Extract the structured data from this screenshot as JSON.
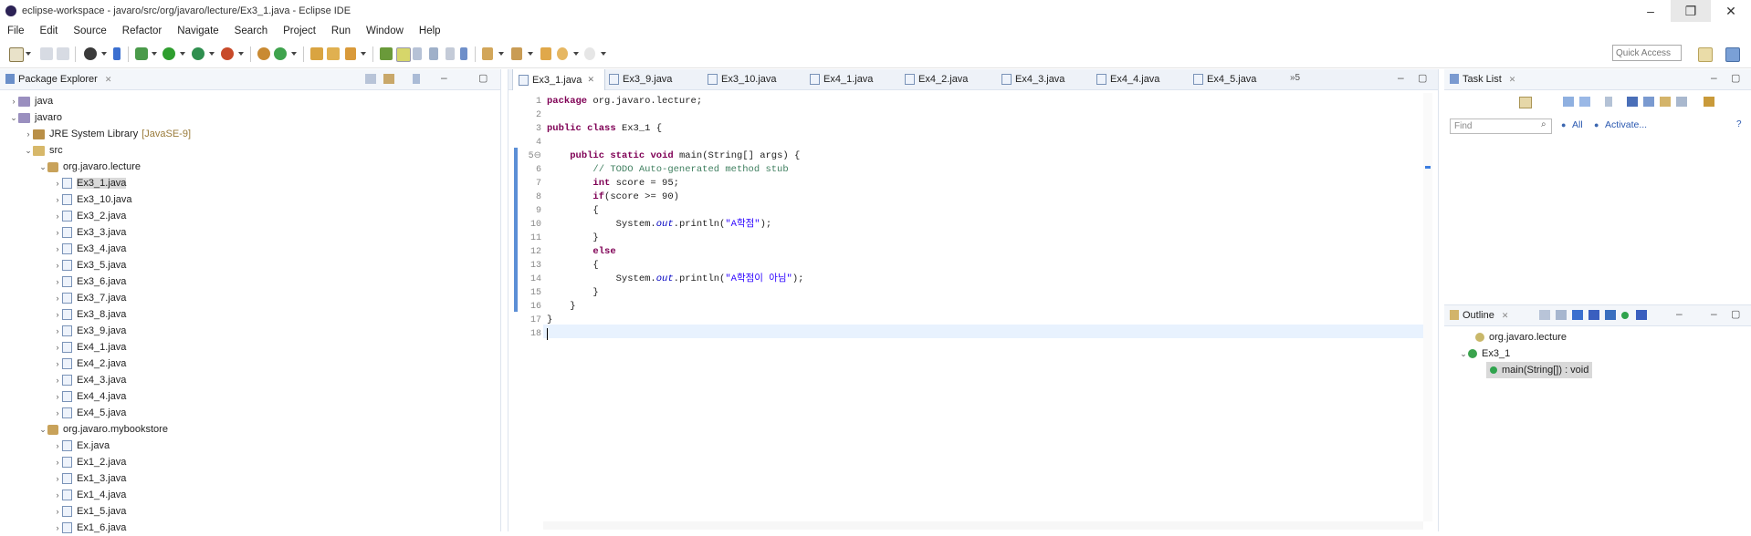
{
  "window": {
    "title": "eclipse-workspace - javaro/src/org/javaro/lecture/Ex3_1.java - Eclipse IDE"
  },
  "menu": [
    "File",
    "Edit",
    "Source",
    "Refactor",
    "Navigate",
    "Search",
    "Project",
    "Run",
    "Window",
    "Help"
  ],
  "toolbar": {
    "quick_access_placeholder": "Quick Access"
  },
  "package_explorer": {
    "title": "Package Explorer",
    "tree": [
      {
        "label": "java",
        "chevron": "›",
        "icon": "project"
      },
      {
        "label": "javaro",
        "chevron": "⌄",
        "icon": "project"
      },
      {
        "label": "JRE System Library",
        "suffix": "[JavaSE-9]",
        "chevron": "›",
        "icon": "library"
      },
      {
        "label": "src",
        "chevron": "⌄",
        "icon": "source-folder"
      },
      {
        "label": "org.javaro.lecture",
        "chevron": "⌄",
        "icon": "package"
      },
      {
        "label": "Ex3_1.java",
        "chevron": "›",
        "icon": "java-file",
        "selected": true
      },
      {
        "label": "Ex3_10.java",
        "chevron": "›",
        "icon": "java-file"
      },
      {
        "label": "Ex3_2.java",
        "chevron": "›",
        "icon": "java-file"
      },
      {
        "label": "Ex3_3.java",
        "chevron": "›",
        "icon": "java-file"
      },
      {
        "label": "Ex3_4.java",
        "chevron": "›",
        "icon": "java-file"
      },
      {
        "label": "Ex3_5.java",
        "chevron": "›",
        "icon": "java-file"
      },
      {
        "label": "Ex3_6.java",
        "chevron": "›",
        "icon": "java-file"
      },
      {
        "label": "Ex3_7.java",
        "chevron": "›",
        "icon": "java-file"
      },
      {
        "label": "Ex3_8.java",
        "chevron": "›",
        "icon": "java-file"
      },
      {
        "label": "Ex3_9.java",
        "chevron": "›",
        "icon": "java-file"
      },
      {
        "label": "Ex4_1.java",
        "chevron": "›",
        "icon": "java-file"
      },
      {
        "label": "Ex4_2.java",
        "chevron": "›",
        "icon": "java-file"
      },
      {
        "label": "Ex4_3.java",
        "chevron": "›",
        "icon": "java-file"
      },
      {
        "label": "Ex4_4.java",
        "chevron": "›",
        "icon": "java-file"
      },
      {
        "label": "Ex4_5.java",
        "chevron": "›",
        "icon": "java-file"
      },
      {
        "label": "org.javaro.mybookstore",
        "chevron": "⌄",
        "icon": "package"
      },
      {
        "label": "Ex.java",
        "chevron": "›",
        "icon": "java-file"
      },
      {
        "label": "Ex1_2.java",
        "chevron": "›",
        "icon": "java-file"
      },
      {
        "label": "Ex1_3.java",
        "chevron": "›",
        "icon": "java-file"
      },
      {
        "label": "Ex1_4.java",
        "chevron": "›",
        "icon": "java-file"
      },
      {
        "label": "Ex1_5.java",
        "chevron": "›",
        "icon": "java-file"
      },
      {
        "label": "Ex1_6.java",
        "chevron": "›",
        "icon": "java-file"
      }
    ]
  },
  "editor": {
    "tabs": [
      {
        "label": "Ex3_1.java",
        "active": true
      },
      {
        "label": "Ex3_9.java"
      },
      {
        "label": "Ex3_10.java"
      },
      {
        "label": "Ex4_1.java"
      },
      {
        "label": "Ex4_2.java"
      },
      {
        "label": "Ex4_3.java"
      },
      {
        "label": "Ex4_4.java"
      },
      {
        "label": "Ex4_5.java"
      }
    ],
    "overflow_count": "»5",
    "lines": [
      {
        "n": "1",
        "t": "package org.javaro.lecture;"
      },
      {
        "n": "2",
        "t": ""
      },
      {
        "n": "3",
        "t": "public class Ex3_1 {"
      },
      {
        "n": "4",
        "t": ""
      },
      {
        "n": "5⊖",
        "t": "    public static void main(String[] args) {"
      },
      {
        "n": "6",
        "t": "        // TODO Auto-generated method stub"
      },
      {
        "n": "7",
        "t": "        int score = 95;"
      },
      {
        "n": "8",
        "t": "        if(score >= 90)"
      },
      {
        "n": "9",
        "t": "        {"
      },
      {
        "n": "10",
        "t": "            System.out.println(\"A학점\");"
      },
      {
        "n": "11",
        "t": "        }"
      },
      {
        "n": "12",
        "t": "        else"
      },
      {
        "n": "13",
        "t": "        {"
      },
      {
        "n": "14",
        "t": "            System.out.println(\"A학점이 아님\");"
      },
      {
        "n": "15",
        "t": "        }"
      },
      {
        "n": "16",
        "t": "    }"
      },
      {
        "n": "17",
        "t": "}"
      },
      {
        "n": "18",
        "t": ""
      }
    ]
  },
  "task_list": {
    "title": "Task List",
    "find_placeholder": "Find",
    "all_label": "All",
    "activate_label": "Activate..."
  },
  "outline": {
    "title": "Outline",
    "items": [
      {
        "label": "org.javaro.lecture"
      },
      {
        "label": "Ex3_1"
      },
      {
        "label": "main(String[]) : void"
      }
    ]
  },
  "colors": {
    "keyword": "#7f0055",
    "comment": "#3f7f5f",
    "string": "#2a00ff",
    "field": "#0000c0",
    "panel_header": "#f3f6fa",
    "current_line": "#e8f2fe"
  }
}
